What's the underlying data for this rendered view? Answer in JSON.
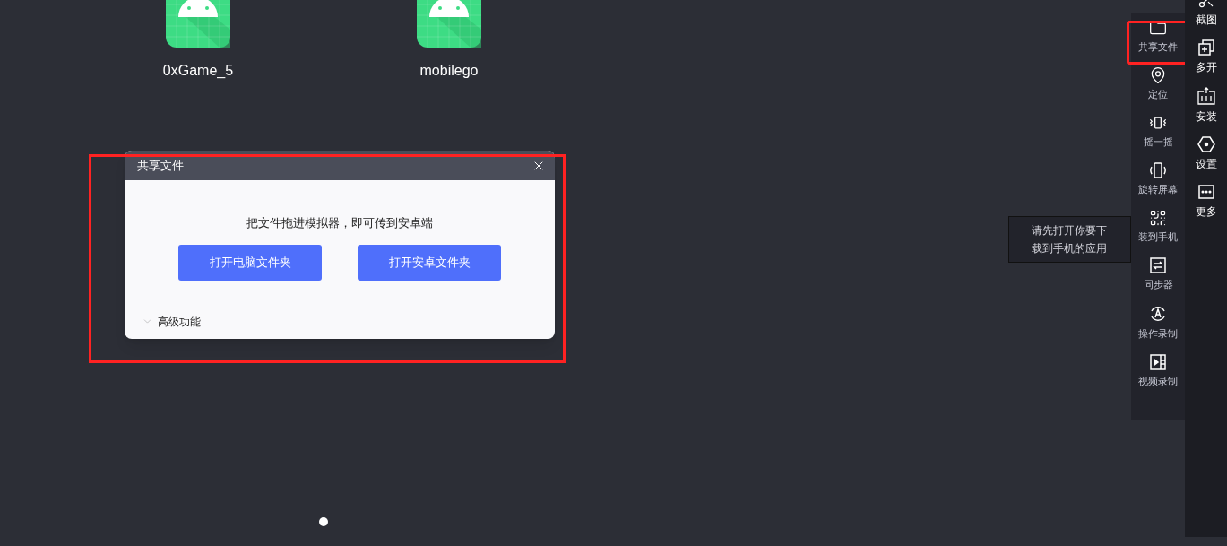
{
  "desktop_apps": [
    {
      "name": "0xGame_5"
    },
    {
      "name": "mobilego"
    }
  ],
  "page_indicator": [
    {
      "selected": true
    }
  ],
  "dialog": {
    "title": "共享文件",
    "message": "把文件拖进模拟器，即可传到安卓端",
    "buttons": [
      "打开电脑文件夹",
      "打开安卓文件夹"
    ],
    "advanced": {
      "label": "高级功能",
      "expanded": false
    }
  },
  "tooltip": {
    "text": "请先打开你要下载到手机的应用"
  },
  "tool_panel": {
    "items": [
      {
        "label": "共享文件"
      },
      {
        "label": "定位"
      },
      {
        "label": "摇一摇"
      },
      {
        "label": "旋转屏幕"
      },
      {
        "label": "装到手机"
      },
      {
        "label": "同步器"
      },
      {
        "label": "操作录制"
      },
      {
        "label": "视频录制"
      }
    ]
  },
  "toolbar": {
    "items": [
      {
        "label": "截图"
      },
      {
        "label": "多开"
      },
      {
        "label": "安装"
      },
      {
        "label": "设置"
      },
      {
        "label": "更多"
      }
    ]
  }
}
